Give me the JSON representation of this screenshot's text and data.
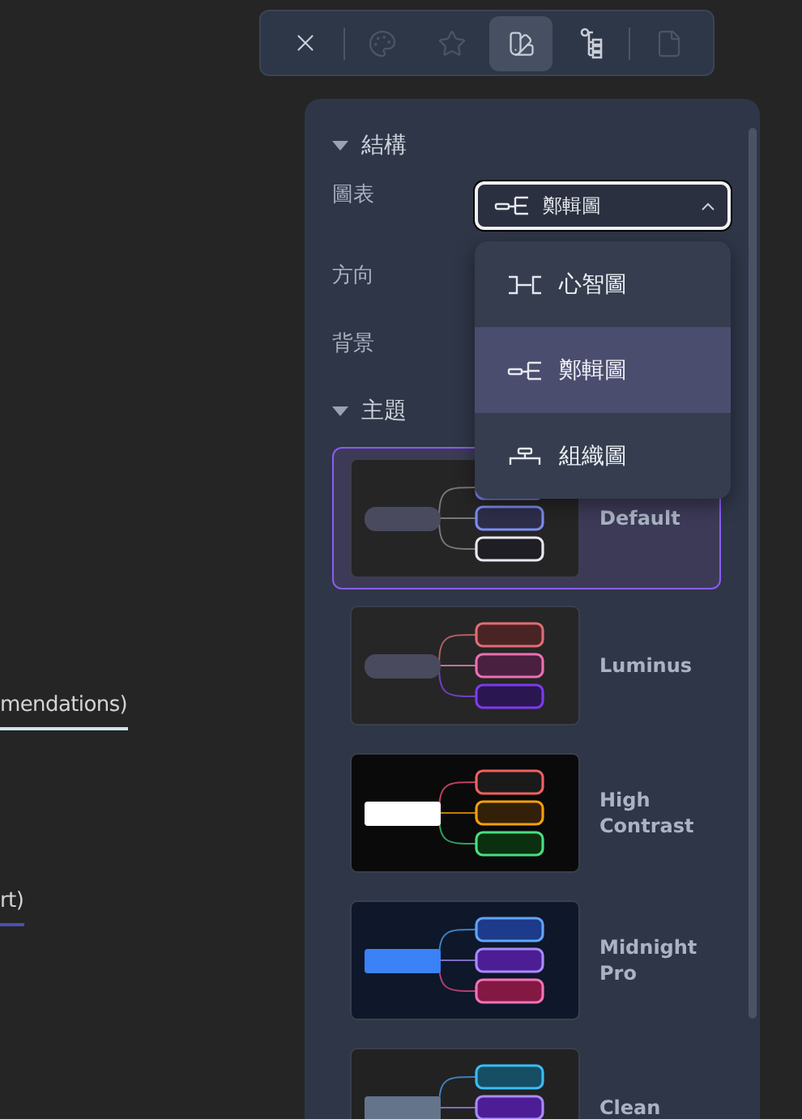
{
  "background_texts": [
    {
      "text": "mendations)",
      "kind": "white"
    },
    {
      "text": "rt)",
      "kind": "blue"
    }
  ],
  "toolbar": {
    "buttons": [
      {
        "kind": "close",
        "selected": false,
        "disabled": false
      },
      {
        "kind": "palette",
        "selected": false,
        "disabled": true
      },
      {
        "kind": "star",
        "selected": false,
        "disabled": true
      },
      {
        "kind": "swatch",
        "selected": true,
        "disabled": false
      },
      {
        "kind": "tree",
        "selected": false,
        "disabled": false
      },
      {
        "kind": "file",
        "selected": false,
        "disabled": true
      }
    ]
  },
  "panel": {
    "structure": {
      "title": "結構",
      "expanded": true,
      "fields": [
        {
          "label": "圖表",
          "kind": "select",
          "value": "鄭輯圖",
          "open": true,
          "options": [
            {
              "label": "心智圖",
              "kind": "mind",
              "selected": false
            },
            {
              "label": "鄭輯圖",
              "kind": "logic",
              "selected": true
            },
            {
              "label": "組織圖",
              "kind": "org",
              "selected": false
            }
          ]
        },
        {
          "label": "方向",
          "kind": "plain"
        },
        {
          "label": "背景",
          "kind": "plain"
        }
      ]
    },
    "theme": {
      "title": "主題",
      "expanded": true,
      "themes": [
        {
          "name": "Default",
          "selected": true
        },
        {
          "name": "Luminus",
          "selected": false
        },
        {
          "name": "High Contrast",
          "selected": false
        },
        {
          "name": "Midnight Pro",
          "selected": false
        },
        {
          "name": "Clean",
          "selected": false
        }
      ]
    }
  }
}
